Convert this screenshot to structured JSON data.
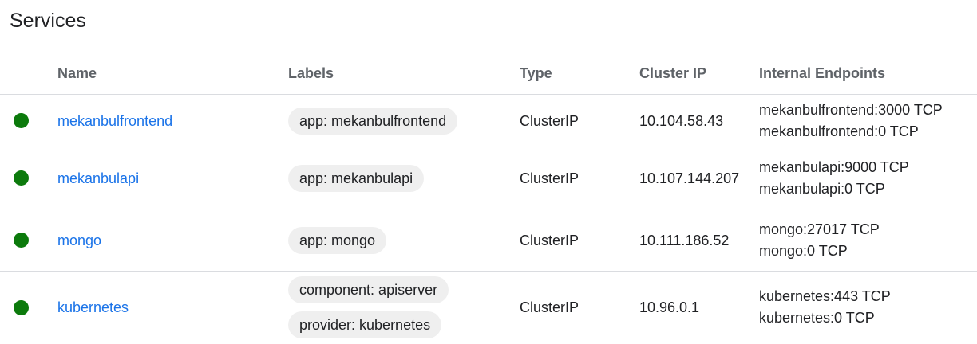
{
  "page": {
    "title": "Services"
  },
  "table": {
    "headers": {
      "name": "Name",
      "labels": "Labels",
      "type": "Type",
      "cluster_ip": "Cluster IP",
      "internal_endpoints": "Internal Endpoints"
    },
    "rows": [
      {
        "status": "running",
        "status_color": "#0c7a0c",
        "name": "mekanbulfrontend",
        "labels": [
          "app: mekanbulfrontend"
        ],
        "type": "ClusterIP",
        "cluster_ip": "10.104.58.43",
        "endpoints": [
          "mekanbulfrontend:3000 TCP",
          "mekanbulfrontend:0 TCP"
        ]
      },
      {
        "status": "running",
        "status_color": "#0c7a0c",
        "name": "mekanbulapi",
        "labels": [
          "app: mekanbulapi"
        ],
        "type": "ClusterIP",
        "cluster_ip": "10.107.144.207",
        "endpoints": [
          "mekanbulapi:9000 TCP",
          "mekanbulapi:0 TCP"
        ]
      },
      {
        "status": "running",
        "status_color": "#0c7a0c",
        "name": "mongo",
        "labels": [
          "app: mongo"
        ],
        "type": "ClusterIP",
        "cluster_ip": "10.111.186.52",
        "endpoints": [
          "mongo:27017 TCP",
          "mongo:0 TCP"
        ]
      },
      {
        "status": "running",
        "status_color": "#0c7a0c",
        "name": "kubernetes",
        "labels": [
          "component: apiserver",
          "provider: kubernetes"
        ],
        "type": "ClusterIP",
        "cluster_ip": "10.96.0.1",
        "endpoints": [
          "kubernetes:443 TCP",
          "kubernetes:0 TCP"
        ]
      }
    ]
  }
}
